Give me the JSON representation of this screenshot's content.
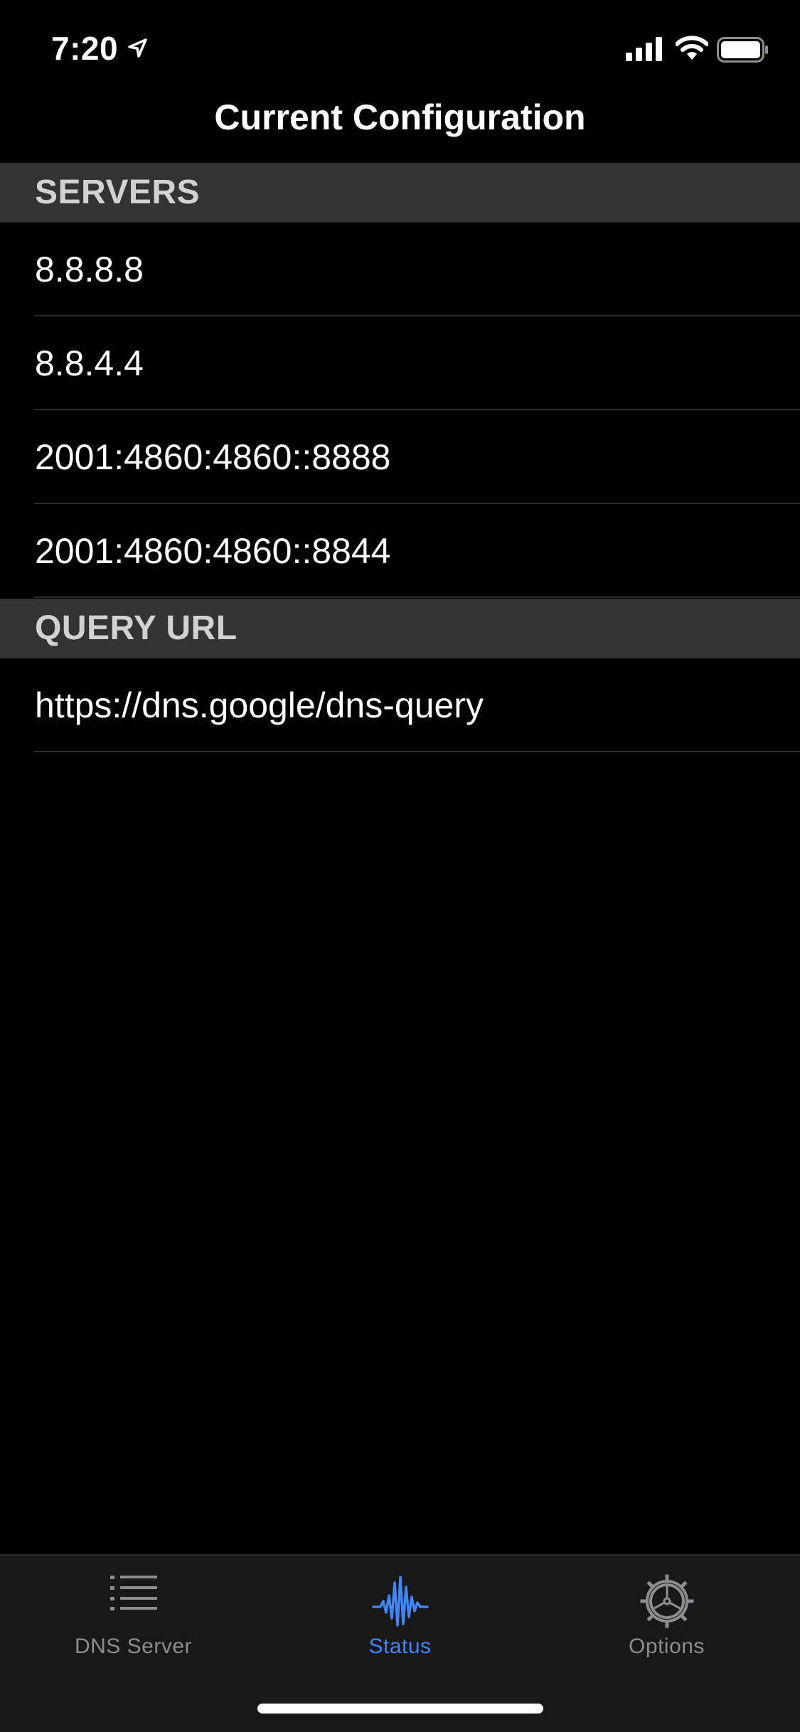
{
  "status_bar": {
    "time": "7:20"
  },
  "nav": {
    "title": "Current Configuration"
  },
  "sections": [
    {
      "header": "SERVERS",
      "rows": [
        "8.8.8.8",
        "8.8.4.4",
        "2001:4860:4860::8888",
        "2001:4860:4860::8844"
      ]
    },
    {
      "header": "QUERY URL",
      "rows": [
        "https://dns.google/dns-query"
      ]
    }
  ],
  "tabs": [
    {
      "label": "DNS Server",
      "icon": "list-icon",
      "active": false
    },
    {
      "label": "Status",
      "icon": "waveform-icon",
      "active": true
    },
    {
      "label": "Options",
      "icon": "gear-icon",
      "active": false
    }
  ],
  "colors": {
    "accent": "#3f86f7",
    "section_header_bg": "#333333",
    "tab_bar_bg": "#181818",
    "inactive_tab": "#8d8d8f"
  }
}
